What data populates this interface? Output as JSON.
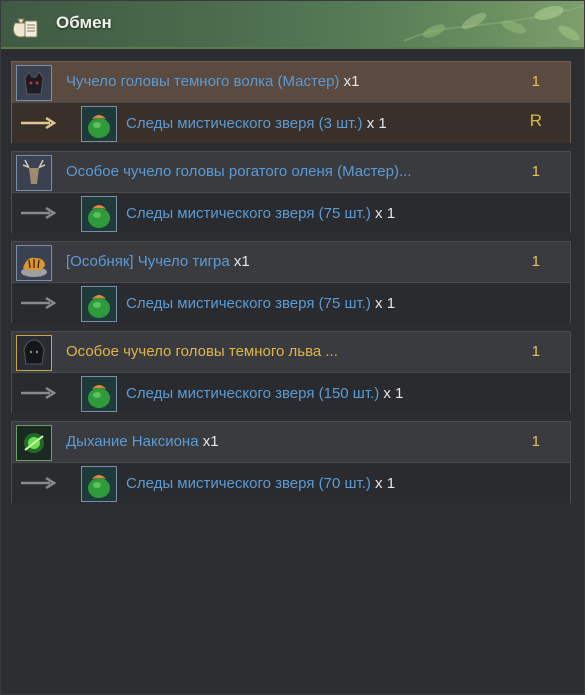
{
  "window": {
    "title": "Обмен"
  },
  "entries": [
    {
      "name": "Чучело головы темного волка (Мастер)",
      "name_qty": "x1",
      "count": "1",
      "reward_name": "Следы мистического зверя (3 шт.)",
      "reward_qty": "x 1",
      "badge": "R",
      "selected": true,
      "icon": "wolf-head-icon"
    },
    {
      "name": "Особое чучело головы рогатого оленя (Мастер)...",
      "name_qty": "",
      "count": "1",
      "reward_name": "Следы мистического зверя (75 шт.)",
      "reward_qty": "x 1",
      "icon": "deer-head-icon"
    },
    {
      "name": "[Особняк] Чучело тигра",
      "name_qty": "x1",
      "count": "1",
      "reward_name": "Следы мистического зверя (75 шт.)",
      "reward_qty": "x 1",
      "icon": "tiger-icon"
    },
    {
      "name": "Особое чучело головы темного льва ...",
      "name_qty": "",
      "count": "1",
      "reward_name": "Следы мистического зверя (150 шт.)",
      "reward_qty": "x 1",
      "icon": "lion-head-icon",
      "name_color": "gold"
    },
    {
      "name": "Дыхание Наксиона",
      "name_qty": "x1",
      "count": "1",
      "reward_name": "Следы мистического зверя (70 шт.)",
      "reward_qty": "x 1",
      "icon": "green-spark-icon"
    }
  ],
  "reward_icon": "green-pouch-icon",
  "colors": {
    "item_blue": "#5b9bd5",
    "item_gold": "#e0b54a",
    "count_yellow": "#e6c25a",
    "header_green": "#4a6b4c"
  }
}
